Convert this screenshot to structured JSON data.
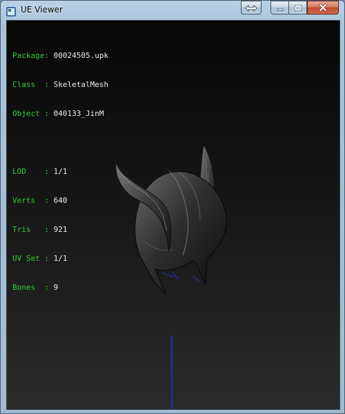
{
  "window": {
    "title": "UE Viewer",
    "icon": "app-icon",
    "buttons": [
      "resize-icon",
      "minimize-icon",
      "maximize-icon",
      "close-icon"
    ]
  },
  "info": {
    "package": {
      "label": "Package:",
      "value": "00024505.upk"
    },
    "class": {
      "label": "Class  :",
      "value": "SkeletalMesh"
    },
    "object": {
      "label": "Object :",
      "value": "040133_JinM"
    },
    "lod": {
      "label": "LOD    :",
      "value": "1/1"
    },
    "verts": {
      "label": "Verts  :",
      "value": "640"
    },
    "tris": {
      "label": "Tris   :",
      "value": "921"
    },
    "uvset": {
      "label": "UV Set :",
      "value": "1/1"
    },
    "bones": {
      "label": "Bones  :",
      "value": "9"
    }
  },
  "colors": {
    "label": "#2fd12f",
    "value": "#eeeeee",
    "axis": "#1a2bd6"
  }
}
